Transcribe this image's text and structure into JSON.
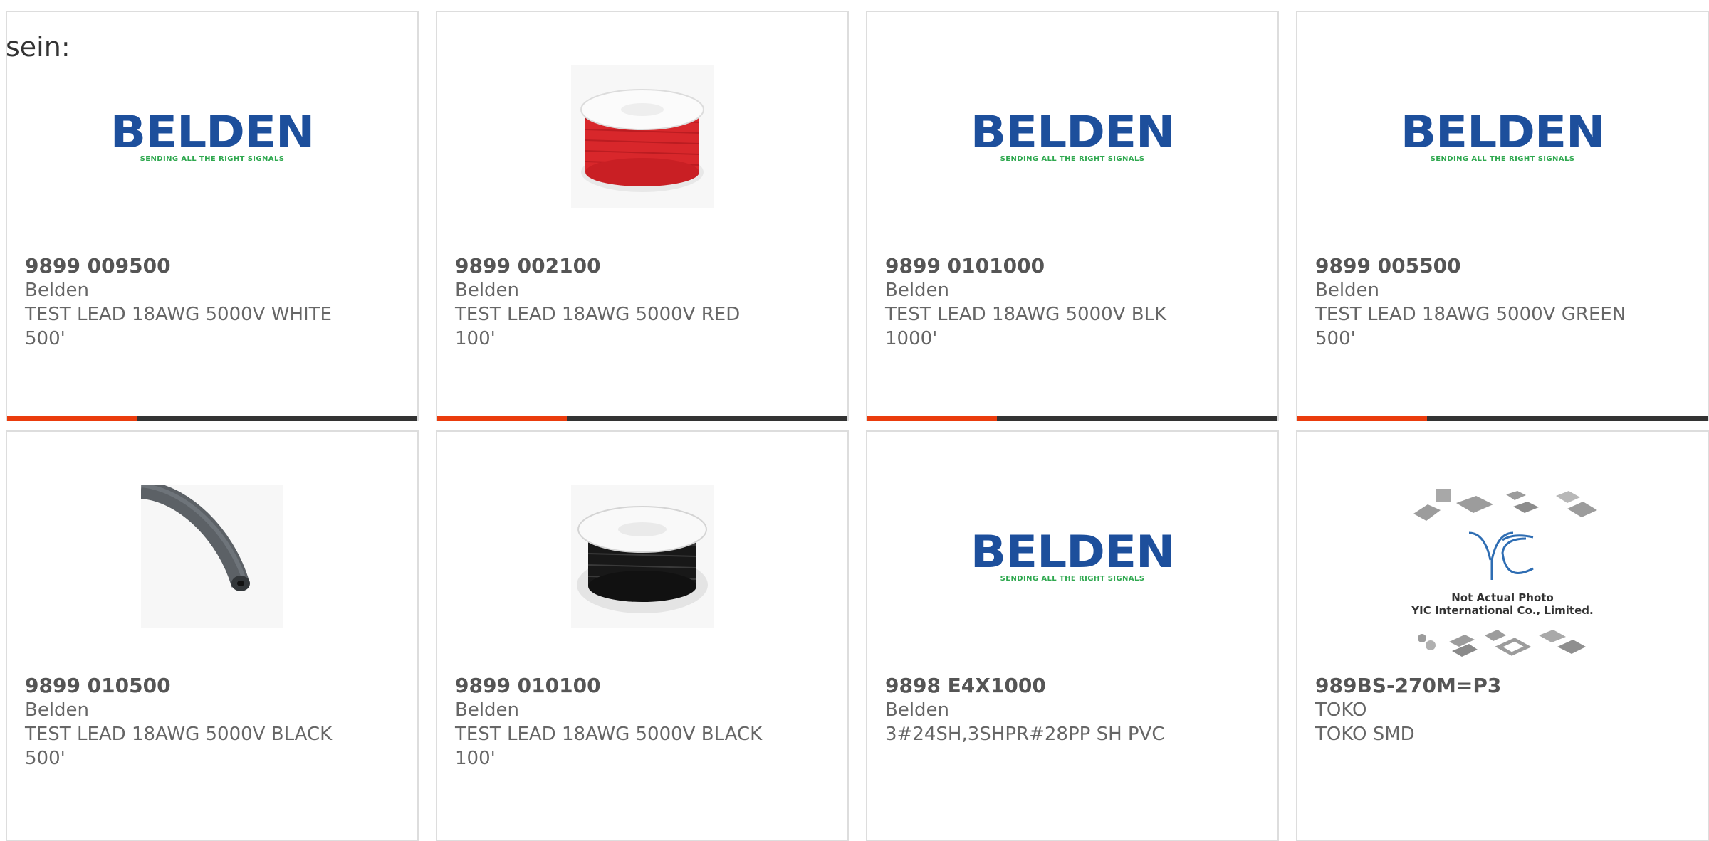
{
  "lead_text": "sein:",
  "logo": {
    "word": "BELDEN",
    "tagline": "SENDING ALL THE RIGHT SIGNALS"
  },
  "colors": {
    "accent": "#ea3c0d",
    "bar": "#333333",
    "border": "#dddddd",
    "text": "#666666",
    "belden_blue": "#1d4f9c",
    "belden_green": "#2fa84f"
  },
  "products": [
    {
      "part_number": "9899 009500",
      "manufacturer": "Belden",
      "description": "TEST LEAD 18AWG 5000V WHITE 500'",
      "image": "belden-logo"
    },
    {
      "part_number": "9899 002100",
      "manufacturer": "Belden",
      "description": "TEST LEAD 18AWG 5000V RED 100'",
      "image": "red-wire-spool"
    },
    {
      "part_number": "9899 0101000",
      "manufacturer": "Belden",
      "description": "TEST LEAD 18AWG 5000V BLK 1000'",
      "image": "belden-logo"
    },
    {
      "part_number": "9899 005500",
      "manufacturer": "Belden",
      "description": "TEST LEAD 18AWG 5000V GREEN 500'",
      "image": "belden-logo"
    },
    {
      "part_number": "9899 010500",
      "manufacturer": "Belden",
      "description": "TEST LEAD 18AWG 5000V BLACK 500'",
      "image": "gray-cable"
    },
    {
      "part_number": "9899 010100",
      "manufacturer": "Belden",
      "description": "TEST LEAD 18AWG 5000V BLACK 100'",
      "image": "black-wire-spool"
    },
    {
      "part_number": "9898 E4X1000",
      "manufacturer": "Belden",
      "description": "3#24SH,3SHPR#28PP SH PVC",
      "image": "belden-logo"
    },
    {
      "part_number": "989BS-270M=P3",
      "manufacturer": "TOKO",
      "description": "TOKO SMD",
      "image": "yic-placeholder"
    }
  ],
  "yic": {
    "line1": "Not Actual Photo",
    "line2": "YIC International Co., Limited."
  }
}
